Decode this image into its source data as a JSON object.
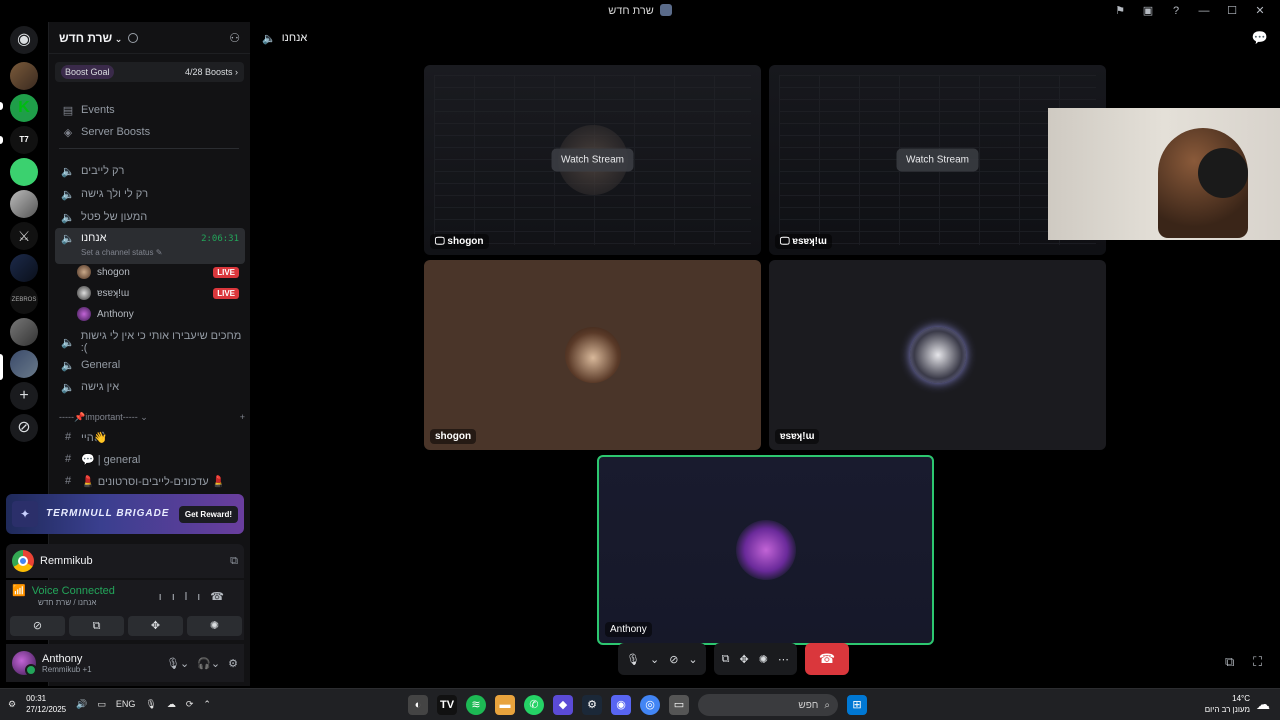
{
  "window": {
    "title": "שרת חדש"
  },
  "server": {
    "name": "שרת חדש",
    "boost_goal": "Boost Goal",
    "boost_count": "4/28 Boosts",
    "events": "Events",
    "server_boosts": "Server Boosts"
  },
  "channels": [
    {
      "name": "רק לייבים"
    },
    {
      "name": "רק לי ולך גישה"
    },
    {
      "name": "המעון של פטל"
    },
    {
      "name": "אנחנו",
      "timer": "2:06:31",
      "status": "Set a channel status"
    },
    {
      "name": "מחכים שיעבירו אותי כי אין לי גישות :("
    },
    {
      "name": "General"
    },
    {
      "name": "אין גישה"
    }
  ],
  "members": [
    {
      "name": "shogon",
      "badge": "LIVE"
    },
    {
      "name": "ɐsɐʞ!ɯ",
      "badge": "LIVE"
    },
    {
      "name": "Anthony"
    }
  ],
  "category": {
    "name": "-----📌important-----"
  },
  "text_channels": [
    {
      "name": "היי👋"
    },
    {
      "name": "💬 | general"
    },
    {
      "name": "💄 עדכונים-לייבים-וסרטונים 💄"
    }
  ],
  "promo": {
    "brand": "TERMINULL BRIGADE",
    "reward": "Get Reward!"
  },
  "activity": {
    "name": "Remmikub"
  },
  "voice": {
    "status": "Voice Connected",
    "location": "אנחנו / שרת חדש"
  },
  "user": {
    "name": "Anthony",
    "sub": "Remmikub +1"
  },
  "main": {
    "channel_title": "אנחנו"
  },
  "tiles": {
    "watch_label": "Watch Stream",
    "shogon": "shogon",
    "emisa": "ɐsɐʞ!ɯ",
    "anthony": "Anthony"
  },
  "taskbar": {
    "time": "00:31",
    "date": "27/12/2025",
    "lang": "ENG",
    "search_placeholder": "חפש",
    "weather_temp": "14°C",
    "weather_desc": "מעונן רב היום"
  },
  "colors": {
    "accent": "#5865f2",
    "live": "#da373c",
    "connected": "#23a55a",
    "hangup": "#da373c"
  }
}
